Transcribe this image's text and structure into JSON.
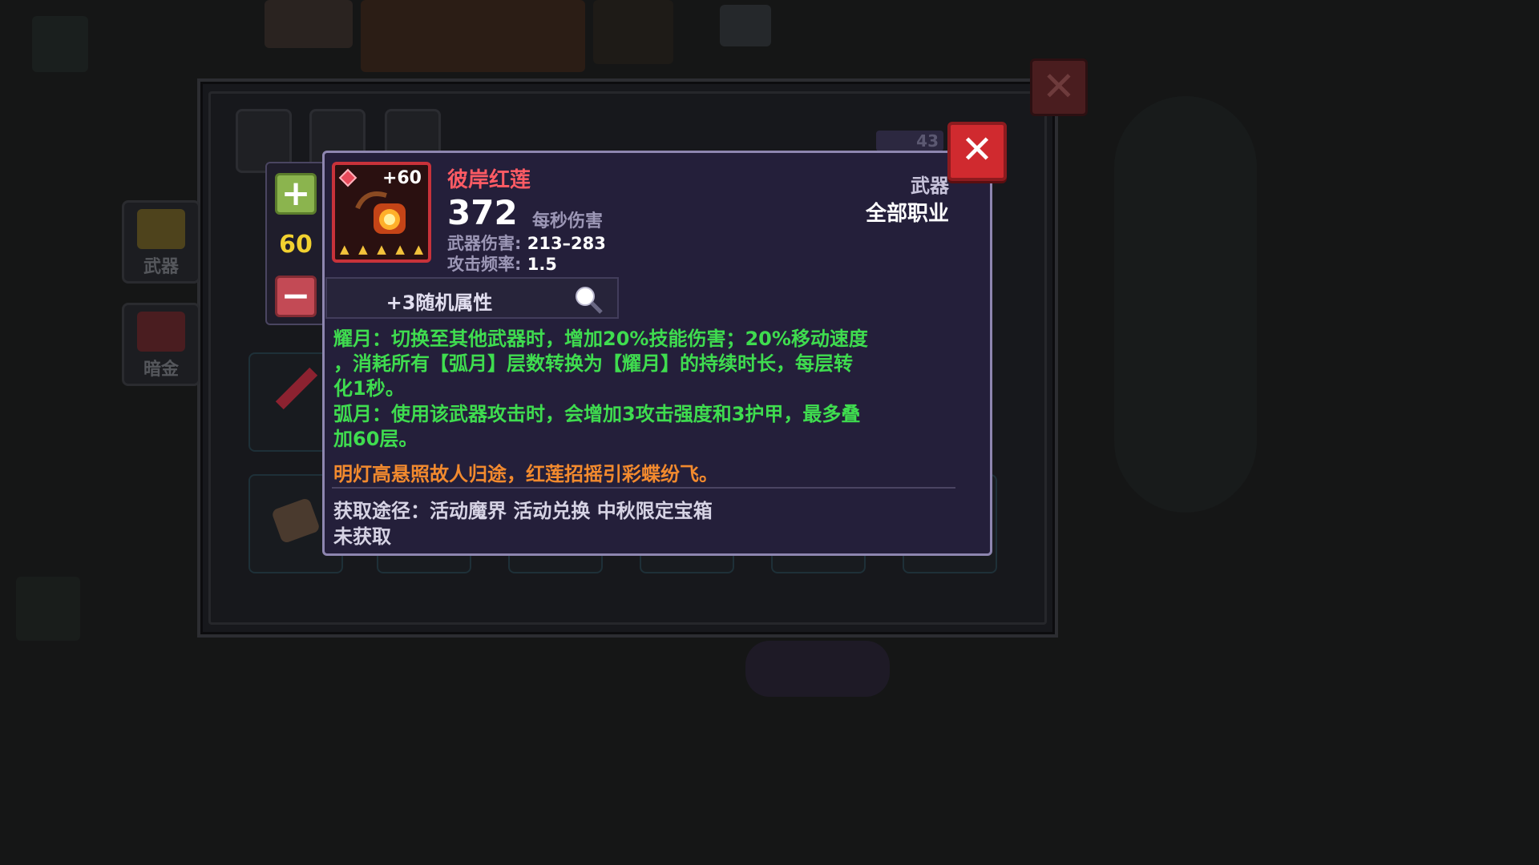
{
  "inventory": {
    "tabs": [
      {
        "label": "武器"
      },
      {
        "label": "暗金"
      }
    ],
    "level_badge": "43"
  },
  "stepper": {
    "plus_label": "+",
    "minus_label": "−",
    "value": "60"
  },
  "item": {
    "enhance": "+60",
    "stars": 5,
    "name": "彼岸红莲",
    "dps": "372",
    "dps_label": "每秒伤害",
    "damage_label": "武器伤害:",
    "damage_value": "213–283",
    "rate_label": "攻击频率:",
    "rate_value": "1.5",
    "type": "武器",
    "class": "全部职业",
    "random_attr": "+3随机属性",
    "desc_lines": [
      "耀月：切换至其他武器时，增加20%技能伤害；20%移动速度",
      "，消耗所有【弧月】层数转换为【耀月】的持续时长，每层转",
      "化1秒。",
      "弧月：使用该武器攻击时，会增加3攻击强度和3护甲，最多叠",
      "加60层。"
    ],
    "flavor": "明灯高悬照故人归途，红莲招摇引彩蝶纷飞。",
    "source": "获取途径：活动魔界  活动兑换 中秋限定宝箱",
    "status": "未获取"
  },
  "colors": {
    "name": "#ff5b64",
    "desc": "#3fdc4f",
    "flavor": "#f28a2e",
    "close": "#d02a2f",
    "stepper_value": "#f1d130"
  },
  "icons": {
    "close": "close-icon",
    "search": "magnifier-icon",
    "plus": "plus-icon",
    "minus": "minus-icon"
  }
}
